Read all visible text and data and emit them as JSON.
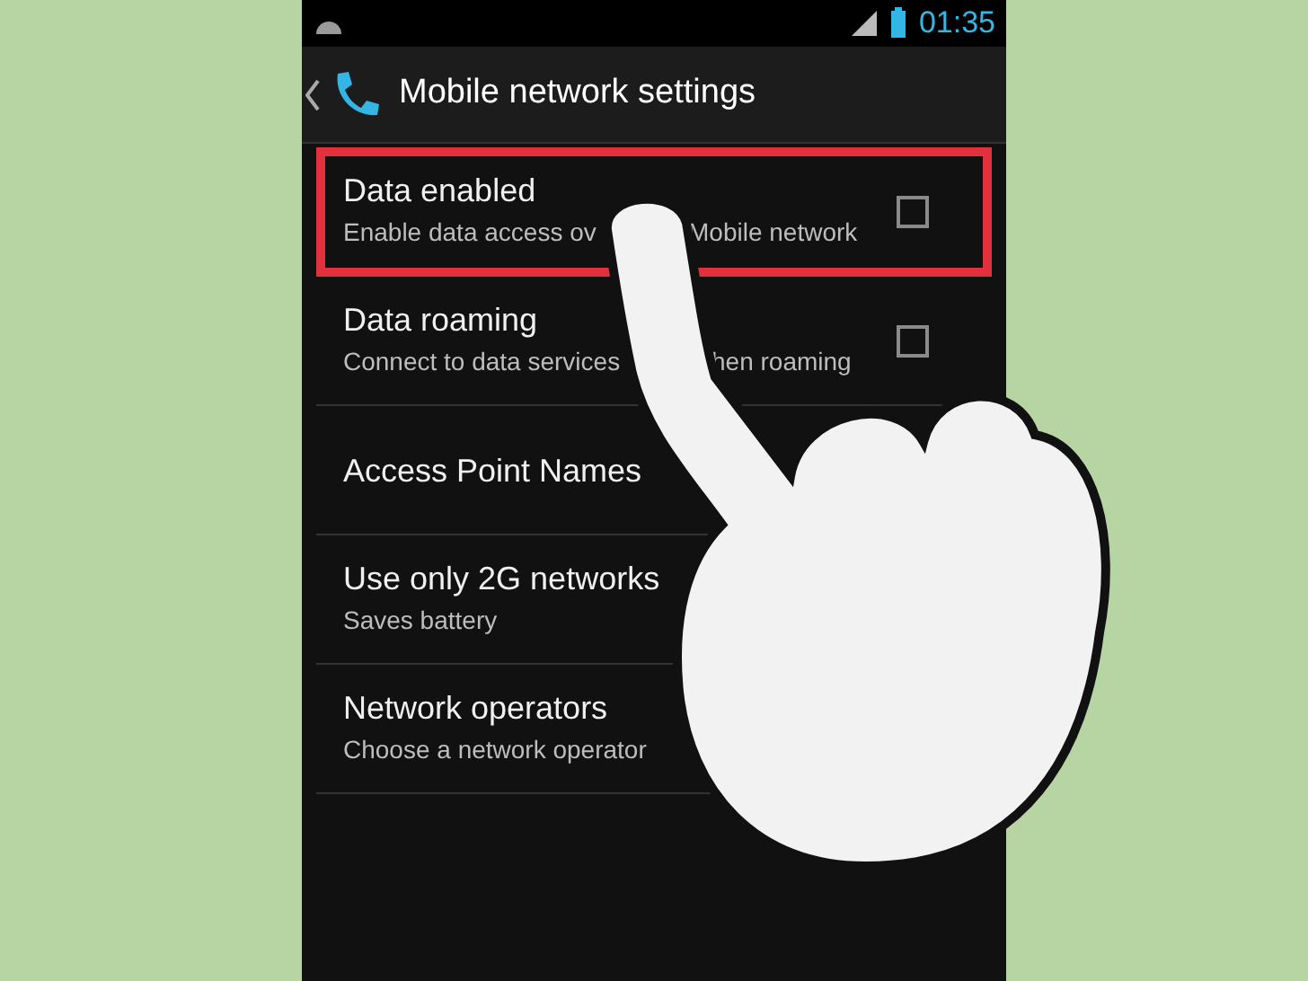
{
  "status_bar": {
    "time": "01:35"
  },
  "action_bar": {
    "title": "Mobile network settings"
  },
  "settings": [
    {
      "kind": "checkbox",
      "title": "Data enabled",
      "summary_parts": [
        "Enable data access ov",
        "Mobile network"
      ],
      "checked": false,
      "highlighted": true
    },
    {
      "kind": "checkbox",
      "title": "Data roaming",
      "summary_parts": [
        "Connect to data services",
        "hen roaming"
      ],
      "checked": false,
      "highlighted": false
    },
    {
      "kind": "plain",
      "title": "Access Point Names",
      "highlighted": false
    },
    {
      "kind": "plain",
      "title": "Use only 2G networks",
      "summary_parts": [
        "Saves battery"
      ],
      "highlighted": false
    },
    {
      "kind": "plain",
      "title": "Network operators",
      "summary_parts": [
        "Choose a network operator"
      ],
      "highlighted": false
    }
  ]
}
